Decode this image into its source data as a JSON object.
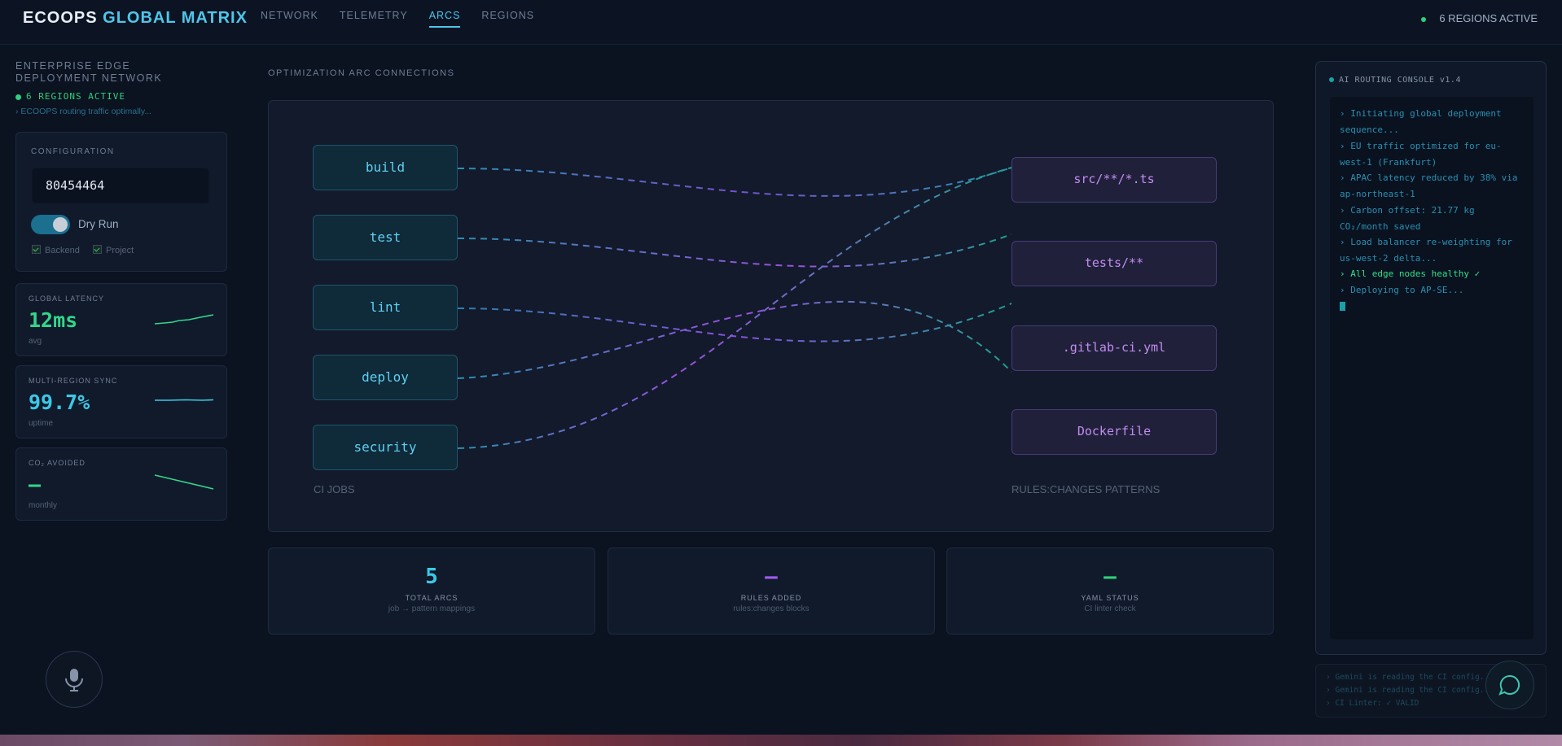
{
  "brand": {
    "prefix": "ECOOPS",
    "accent": "GLOBAL MATRIX"
  },
  "nav": {
    "tabs": [
      "NETWORK",
      "TELEMETRY",
      "ARCS",
      "REGIONS"
    ],
    "active": "ARCS"
  },
  "top_status": "6 REGIONS ACTIVE",
  "sidebar": {
    "title": "ENTERPRISE EDGE DEPLOYMENT NETWORK",
    "regions": "6 REGIONS ACTIVE",
    "routing": "› ECOOPS routing traffic optimally..."
  },
  "config": {
    "label": "CONFIGURATION",
    "input_value": "80454464",
    "toggle_label": "Dry Run",
    "toggle_on": true,
    "checkbox_backend": "Backend",
    "checkbox_project": "Project"
  },
  "metrics": [
    {
      "label": "GLOBAL LATENCY",
      "value": "12ms",
      "sub": "avg",
      "color": "#34d68a"
    },
    {
      "label": "MULTI-REGION SYNC",
      "value": "99.7%",
      "sub": "uptime",
      "color": "#3cc8e6"
    },
    {
      "label": "CO₂ AVOIDED",
      "value": "—",
      "sub": "monthly",
      "color": "#34d68a"
    }
  ],
  "arcs": {
    "section_title": "OPTIMIZATION ARC CONNECTIONS",
    "jobs": [
      "build",
      "test",
      "lint",
      "deploy",
      "security"
    ],
    "patterns": [
      "src/**/*.ts",
      "tests/**",
      ".gitlab-ci.yml",
      "Dockerfile"
    ],
    "jobs_label": "CI JOBS",
    "patterns_label": "RULES:CHANGES PATTERNS"
  },
  "stats": [
    {
      "value": "5",
      "label": "TOTAL ARCS",
      "sub": "job → pattern mappings",
      "color": "#3cc8e6"
    },
    {
      "value": "—",
      "label": "RULES ADDED",
      "sub": "rules:changes blocks",
      "color": "#a05cf0"
    },
    {
      "value": "—",
      "label": "YAML STATUS",
      "sub": "CI linter check",
      "color": "#2fd07b"
    }
  ],
  "console": {
    "title": "AI ROUTING CONSOLE v1.4",
    "lines": [
      "› Initiating global deployment sequence...",
      "› EU traffic optimized for eu-west-1 (Frankfurt)",
      "› APAC latency reduced by 38% via ap-northeast-1",
      "› Carbon offset: 21.77 kg CO₂/month saved",
      "› Load balancer re-weighting for us-west-2 delta...",
      "› All edge nodes healthy ✓",
      "› Deploying to AP-SE..."
    ]
  },
  "ticker": [
    "› Gemini is reading the CI config...",
    "› Gemini is reading the CI config...",
    "› CI Linter: ✓ VALID"
  ],
  "icons": {
    "mic": "mic-icon",
    "chat": "chat-icon"
  },
  "colors": {
    "accent": "#4fc6ea",
    "green": "#2fd07b",
    "purple": "#a05cf0",
    "bg": "#0b1220"
  }
}
